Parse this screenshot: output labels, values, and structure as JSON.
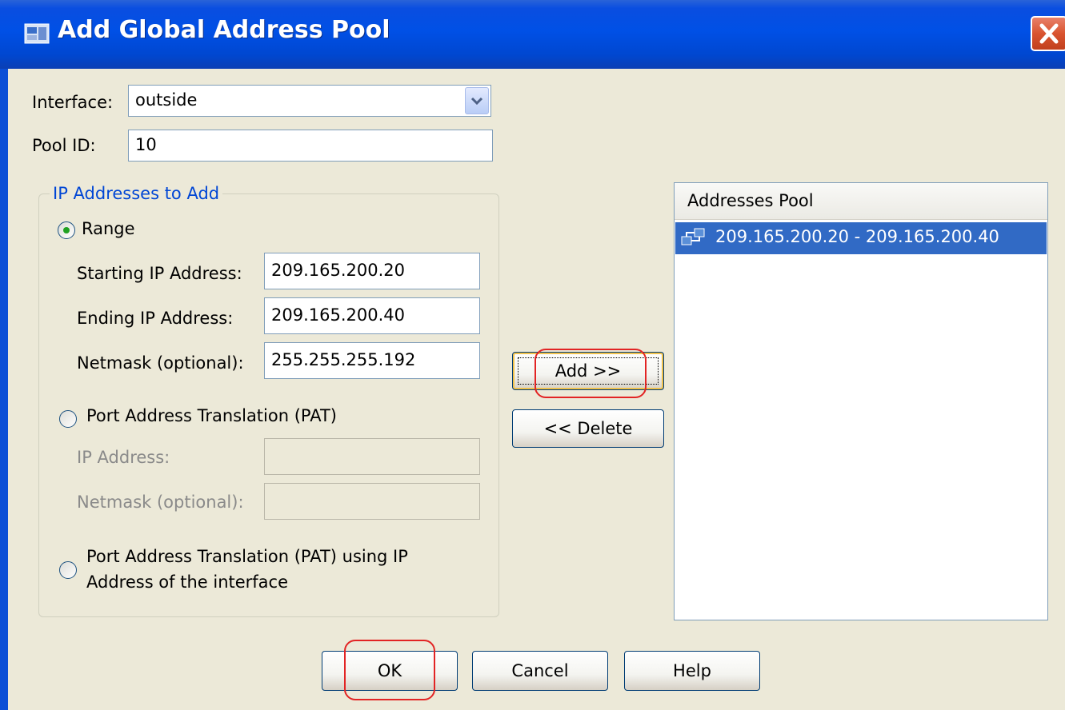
{
  "window": {
    "title": "Add Global Address Pool",
    "title_icon": "asdm-app-icon",
    "close_icon": "close-x-icon"
  },
  "form": {
    "interface_label": "Interface:",
    "interface_value": "outside",
    "pool_id_label": "Pool ID:",
    "pool_id_value": "10"
  },
  "group": {
    "legend": "IP Addresses to Add",
    "range_label": "Range",
    "range_selected": true,
    "starting_ip_label": "Starting IP Address:",
    "starting_ip_value": "209.165.200.20",
    "ending_ip_label": "Ending  IP Address:",
    "ending_ip_value": "209.165.200.40",
    "netmask_label": "Netmask (optional):",
    "netmask_value": "255.255.255.192",
    "pat_label": "Port Address Translation (PAT)",
    "pat_ip_label": "IP Address:",
    "pat_ip_value": "",
    "pat_netmask_label": "Netmask (optional):",
    "pat_netmask_value": "",
    "pat_interface_label_line1": "Port Address Translation (PAT) using IP",
    "pat_interface_label_line2": "Address of the interface"
  },
  "actions": {
    "add_label": "Add >>",
    "delete_label": "<< Delete"
  },
  "pool_list": {
    "header": "Addresses Pool",
    "items": [
      {
        "icon": "network-icon",
        "text": "209.165.200.20 - 209.165.200.40",
        "selected": true
      }
    ]
  },
  "footer": {
    "ok_label": "OK",
    "cancel_label": "Cancel",
    "help_label": "Help"
  },
  "colors": {
    "title_blue": "#0050e6",
    "selection_blue": "#316ac5",
    "annotation_red": "#e22424",
    "legend_blue": "#0046d5",
    "dialog_bg": "#ece9d8"
  }
}
